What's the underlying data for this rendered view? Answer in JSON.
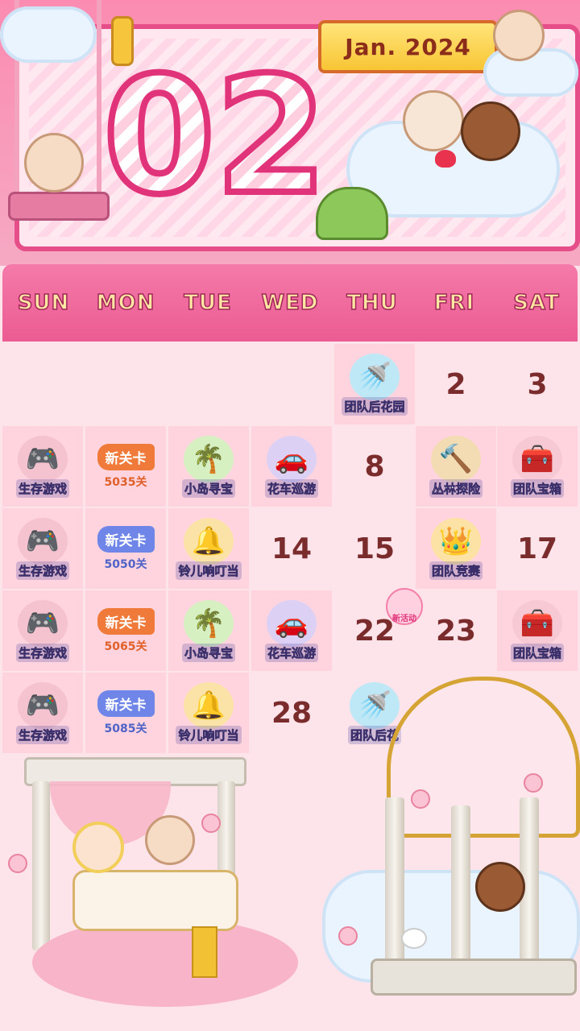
{
  "header": {
    "month_year": "Jan. 2024",
    "big_date": "02"
  },
  "weekdays": [
    "SUN",
    "MON",
    "TUE",
    "WED",
    "THU",
    "FRI",
    "SAT"
  ],
  "calendar": {
    "plain_days": {
      "d2": "2",
      "d3": "3",
      "d8": "8",
      "d14": "14",
      "d15": "15",
      "d17": "17",
      "d22": "22",
      "d23": "23",
      "d28": "28"
    },
    "events": {
      "team_garden": "团队后花园",
      "survival_game": "生存游戏",
      "island_treasure": "小岛寻宝",
      "float_parade": "花车巡游",
      "jungle_explore": "丛林探险",
      "team_chest": "团队宝箱",
      "jingle_bell": "铃儿响叮当",
      "team_contest": "团队竞赛",
      "team_garden_cut": "团队后花"
    },
    "new_level": "新关卡",
    "levels": {
      "l1": "5035关",
      "l2": "5050关",
      "l3": "5065关",
      "l4": "5085关"
    },
    "new_activity_badge": "新活动"
  },
  "colors": {
    "accent_pink": "#ec5c92",
    "cell_pink": "#ffd4de",
    "day_number": "#7a2c2c",
    "ribbon_orange": "#f07a3a",
    "ribbon_blue": "#6f86e8"
  },
  "icons": {
    "survival_game": "squid-game-icon",
    "island_treasure": "palm-tree-icon",
    "float_parade": "flower-car-icon",
    "jungle_explore": "hammer-icon",
    "team_chest": "treasure-chest-icon",
    "jingle_bell": "bell-icon",
    "team_contest": "crown-icon",
    "team_garden": "watering-can-icon"
  }
}
